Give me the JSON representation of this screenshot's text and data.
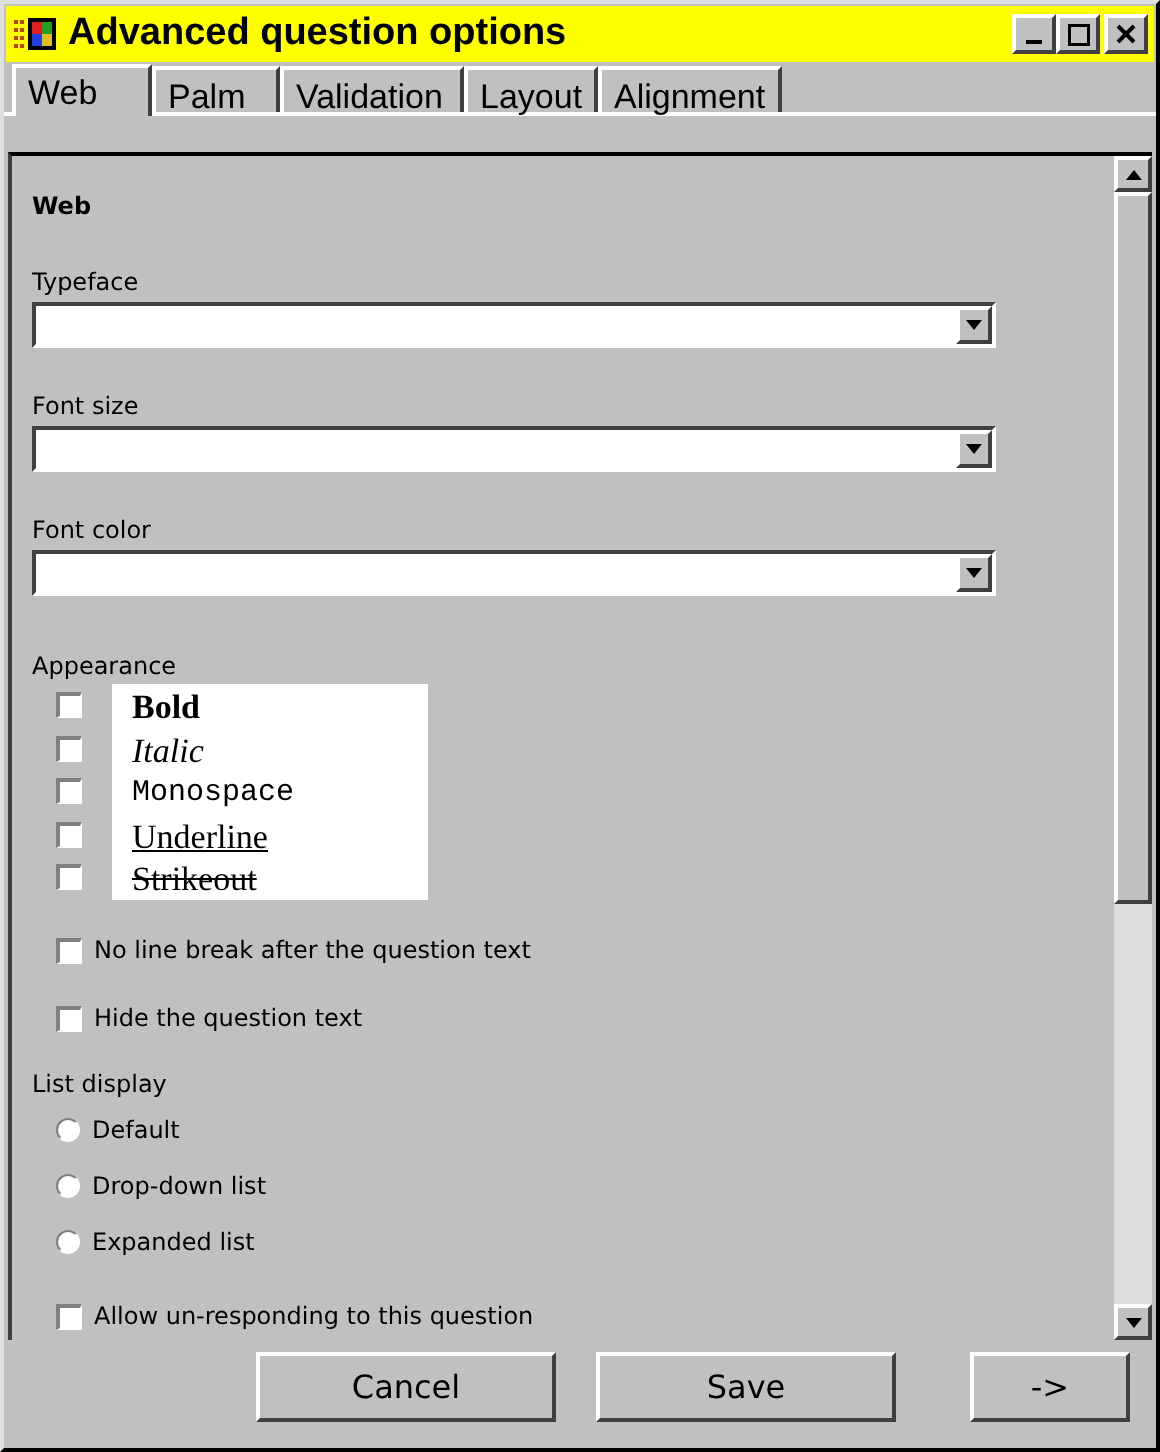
{
  "window": {
    "title": "Advanced question options"
  },
  "tabs": [
    {
      "label": "Web",
      "selected": true
    },
    {
      "label": "Palm",
      "selected": false
    },
    {
      "label": "Validation",
      "selected": false
    },
    {
      "label": "Layout",
      "selected": false
    },
    {
      "label": "Alignment",
      "selected": false
    }
  ],
  "section_title": "Web",
  "dropdowns": [
    {
      "label": "Typeface"
    },
    {
      "label": "Font size"
    },
    {
      "label": "Font color"
    }
  ],
  "appearance": {
    "label": "Appearance",
    "options": [
      {
        "label": "Bold",
        "kind": "bold",
        "checked": false
      },
      {
        "label": "Italic",
        "kind": "italic",
        "checked": false
      },
      {
        "label": "Monospace",
        "kind": "mono",
        "checked": false
      },
      {
        "label": "Underline",
        "kind": "underline",
        "checked": false
      },
      {
        "label": "Strikeout",
        "kind": "strike",
        "checked": false
      }
    ]
  },
  "options": [
    {
      "label": "No line break after the question text",
      "checked": false
    },
    {
      "label": "Hide the question text",
      "checked": false
    }
  ],
  "list_display": {
    "label": "List display",
    "choices": [
      {
        "label": "Default",
        "selected": false
      },
      {
        "label": "Drop-down list",
        "selected": false
      },
      {
        "label": "Expanded list",
        "selected": false
      }
    ]
  },
  "allow_option": {
    "label": "Allow un-responding to this question",
    "checked": false
  },
  "buttons": [
    "Cancel",
    "Save",
    "->"
  ]
}
